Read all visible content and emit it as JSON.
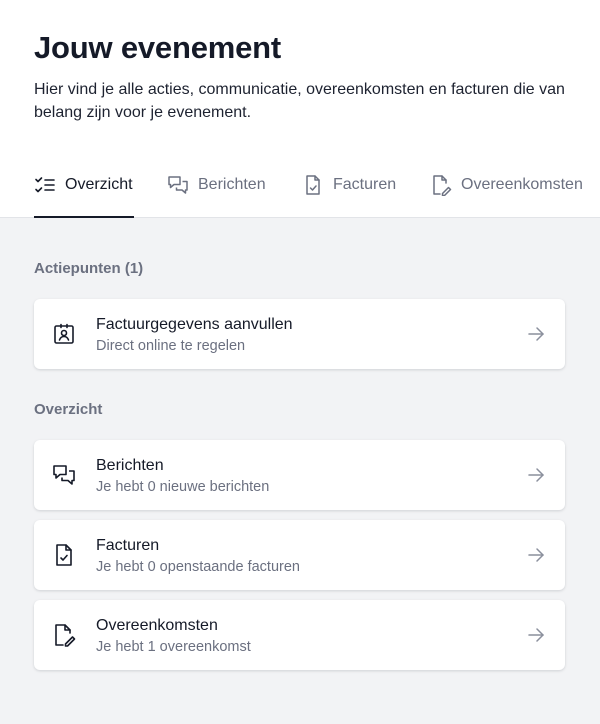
{
  "header": {
    "title": "Jouw evenement",
    "description": "Hier vind je alle acties, communicatie, overeenkomsten en facturen die van belang zijn voor je evenement."
  },
  "tabs": [
    {
      "label": "Overzicht",
      "icon": "checklist-icon",
      "active": true
    },
    {
      "label": "Berichten",
      "icon": "chat-icon",
      "active": false
    },
    {
      "label": "Facturen",
      "icon": "document-check-icon",
      "active": false
    },
    {
      "label": "Overeenkomsten",
      "icon": "document-edit-icon",
      "active": false
    }
  ],
  "action_points": {
    "title": "Actiepunten (1)",
    "items": [
      {
        "title": "Factuurgegevens aanvullen",
        "subtitle": "Direct online te regelen",
        "icon": "contact-badge-icon"
      }
    ]
  },
  "overview": {
    "title": "Overzicht",
    "items": [
      {
        "title": "Berichten",
        "subtitle": "Je hebt 0 nieuwe berichten",
        "icon": "chat-icon"
      },
      {
        "title": "Facturen",
        "subtitle": "Je hebt 0 openstaande facturen",
        "icon": "document-check-icon"
      },
      {
        "title": "Overeenkomsten",
        "subtitle": "Je hebt 1 overeenkomst",
        "icon": "document-edit-icon"
      }
    ]
  },
  "colors": {
    "text": "#151a28",
    "muted": "#6b7080",
    "background": "#f2f3f5",
    "card": "#ffffff"
  }
}
